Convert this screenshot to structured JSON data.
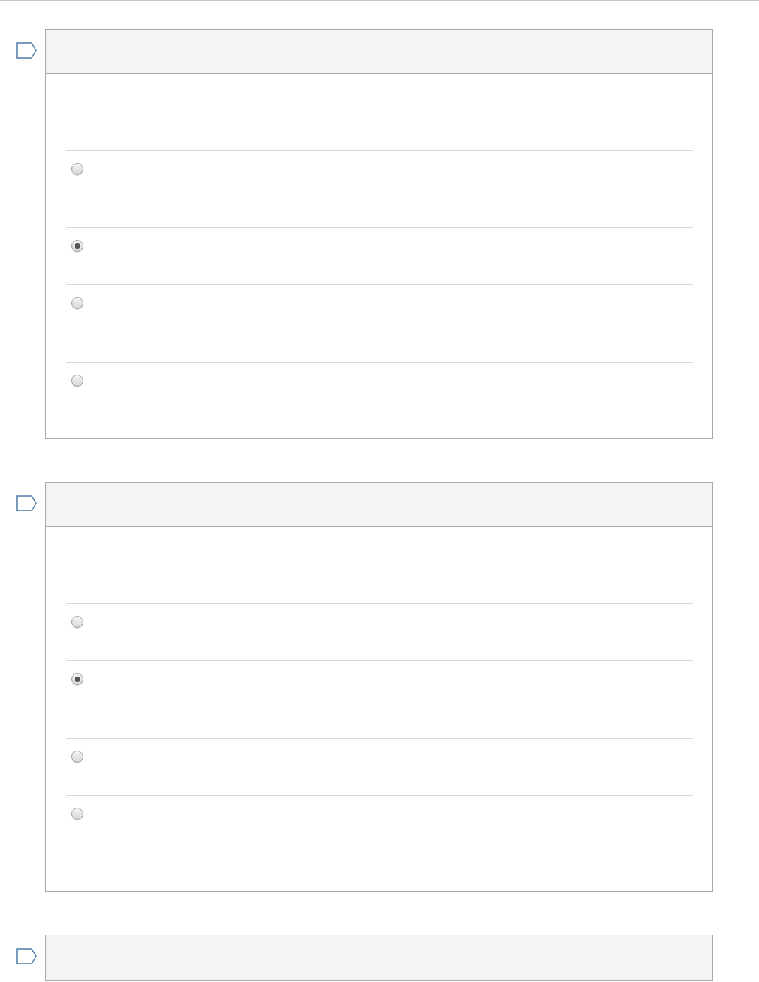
{
  "questions": [
    {
      "kind": "full",
      "options": [
        {
          "selected": false
        },
        {
          "selected": true
        },
        {
          "selected": false
        },
        {
          "selected": false
        }
      ]
    },
    {
      "kind": "full",
      "options": [
        {
          "selected": false
        },
        {
          "selected": true
        },
        {
          "selected": false
        },
        {
          "selected": false
        }
      ]
    },
    {
      "kind": "header"
    }
  ]
}
